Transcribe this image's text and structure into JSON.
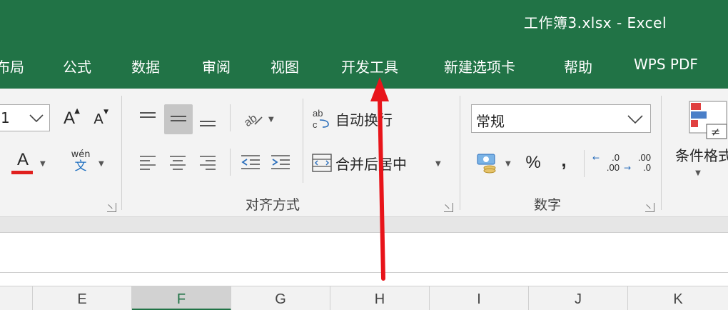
{
  "window": {
    "title": "工作簿3.xlsx  -  Excel"
  },
  "tabs": [
    "布局",
    "公式",
    "数据",
    "审阅",
    "视图",
    "开发工具",
    "新建选项卡",
    "帮助",
    "WPS PDF"
  ],
  "ribbon": {
    "font": {
      "size_value": "1",
      "grow_label": "A",
      "shrink_label": "A",
      "font_color_label": "A",
      "phonetic_top": "wén",
      "phonetic_bottom": "文"
    },
    "alignment": {
      "wrap_text_label": "自动换行",
      "merge_center_label": "合并后居中",
      "group_label": "对齐方式"
    },
    "number": {
      "format_value": "常规",
      "percent_label": "%",
      "comma_label": ",",
      "increase_decimal_top": ".0",
      "increase_decimal_bottom": ".00",
      "decrease_decimal_top": ".00",
      "decrease_decimal_bottom": ".0",
      "group_label": "数字"
    },
    "styles": {
      "conditional_format_label": "条件格式"
    }
  },
  "columns": [
    "E",
    "F",
    "G",
    "H",
    "I",
    "J",
    "K"
  ],
  "active_column": "F",
  "colors": {
    "accent": "#217346",
    "arrow": "#e8141a",
    "font_color_bar": "#e0201e"
  }
}
